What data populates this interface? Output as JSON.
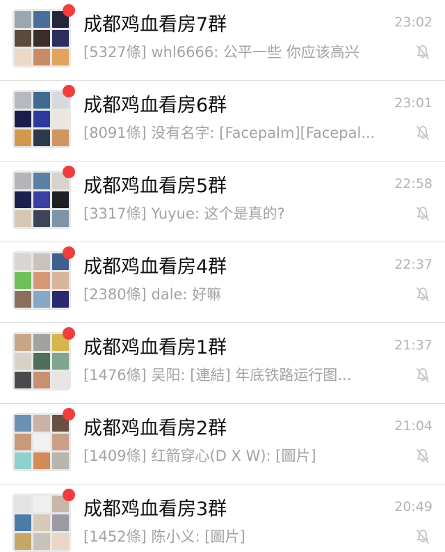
{
  "chats": [
    {
      "name": "成都鸡血看房7群",
      "time": "23:02",
      "preview": "[5327條] whl6666: 公平一些 你应该高兴",
      "tiles": [
        "#9aa7b0",
        "#4a6e9b",
        "#22283a",
        "#5c4a3f",
        "#3a2d2a",
        "#2b2e5f",
        "#ead9c4",
        "#c88b64",
        "#e1a45a"
      ]
    },
    {
      "name": "成都鸡血看房6群",
      "time": "23:01",
      "preview": "[8091條] 没有名字: [Facepalm][Facepal...",
      "tiles": [
        "#b7b9bf",
        "#3d6b92",
        "#d7d9de",
        "#1c1b4a",
        "#2c3a9b",
        "#ece6e0",
        "#d1984e",
        "#2e3a4c",
        "#cf9760"
      ]
    },
    {
      "name": "成都鸡血看房5群",
      "time": "22:58",
      "preview": "[3317條] Yuyue: 这个是真的?",
      "tiles": [
        "#b3b5b9",
        "#5c7fa6",
        "#d8d2cc",
        "#1d1f4d",
        "#3a3fa1",
        "#1e2026",
        "#d6c6b4",
        "#3c4553",
        "#7d93a8"
      ]
    },
    {
      "name": "成都鸡血看房4群",
      "time": "22:37",
      "preview": "[2380條] dale: 好嘛",
      "tiles": [
        "#d8d5d2",
        "#c9c2bd",
        "#3f5f8c",
        "#6fbf5a",
        "#d69775",
        "#d8b59a",
        "#8b6f5c",
        "#87a7c7",
        "#2b2a6e"
      ]
    },
    {
      "name": "成都鸡血看房1群",
      "time": "21:37",
      "preview": "[1476條] 吴阳: [連結] 年底铁路运行图...",
      "tiles": [
        "#c7a587",
        "#a3a29e",
        "#d6b44e",
        "#d9d1c7",
        "#4e6f5a",
        "#7fa58c",
        "#4a4a4a",
        "#c98f72",
        "#e5e5e5"
      ]
    },
    {
      "name": "成都鸡血看房2群",
      "time": "21:04",
      "preview": "[1409條] 红箭穿心(D X W): [圖片]",
      "tiles": [
        "#6d8fb2",
        "#c8b3a5",
        "#6a4f44",
        "#c79a7a",
        "#f1f1f1",
        "#caa089",
        "#8fd1cf",
        "#d58a5a",
        "#b9b4ae"
      ]
    },
    {
      "name": "成都鸡血看房3群",
      "time": "20:49",
      "preview": "[1452條] 陈小义: [圖片]",
      "tiles": [
        "#e3e3e3",
        "#efefef",
        "#c7b6a9",
        "#4d7ba8",
        "#d8c9b8",
        "#9c9aa3",
        "#c7a66a",
        "#c8c2bb",
        "#e8d7c7"
      ]
    }
  ]
}
